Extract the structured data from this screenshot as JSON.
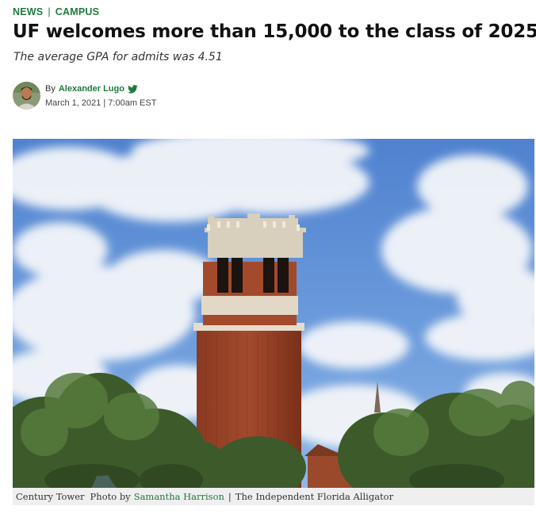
{
  "categories": [
    "NEWS",
    "CAMPUS"
  ],
  "category_separator": "|",
  "headline": "UF welcomes more than 15,000 to the class of 2025",
  "subheadline": "The average GPA for admits was 4.51",
  "byline": {
    "prefix": "By",
    "author": "Alexander Lugo",
    "date": "March 1, 2021 | 7:00am EST"
  },
  "caption": {
    "subject": "Century Tower",
    "photo_prefix": "Photo by",
    "photographer": "Samantha Harrison",
    "separator": "|",
    "publication": "The Independent Florida Alligator"
  },
  "colors": {
    "accent": "#1e7a3c",
    "caption_bg": "#efefef",
    "twitter": "#1e7a3c"
  },
  "icons": {
    "author_social": "twitter-icon"
  }
}
